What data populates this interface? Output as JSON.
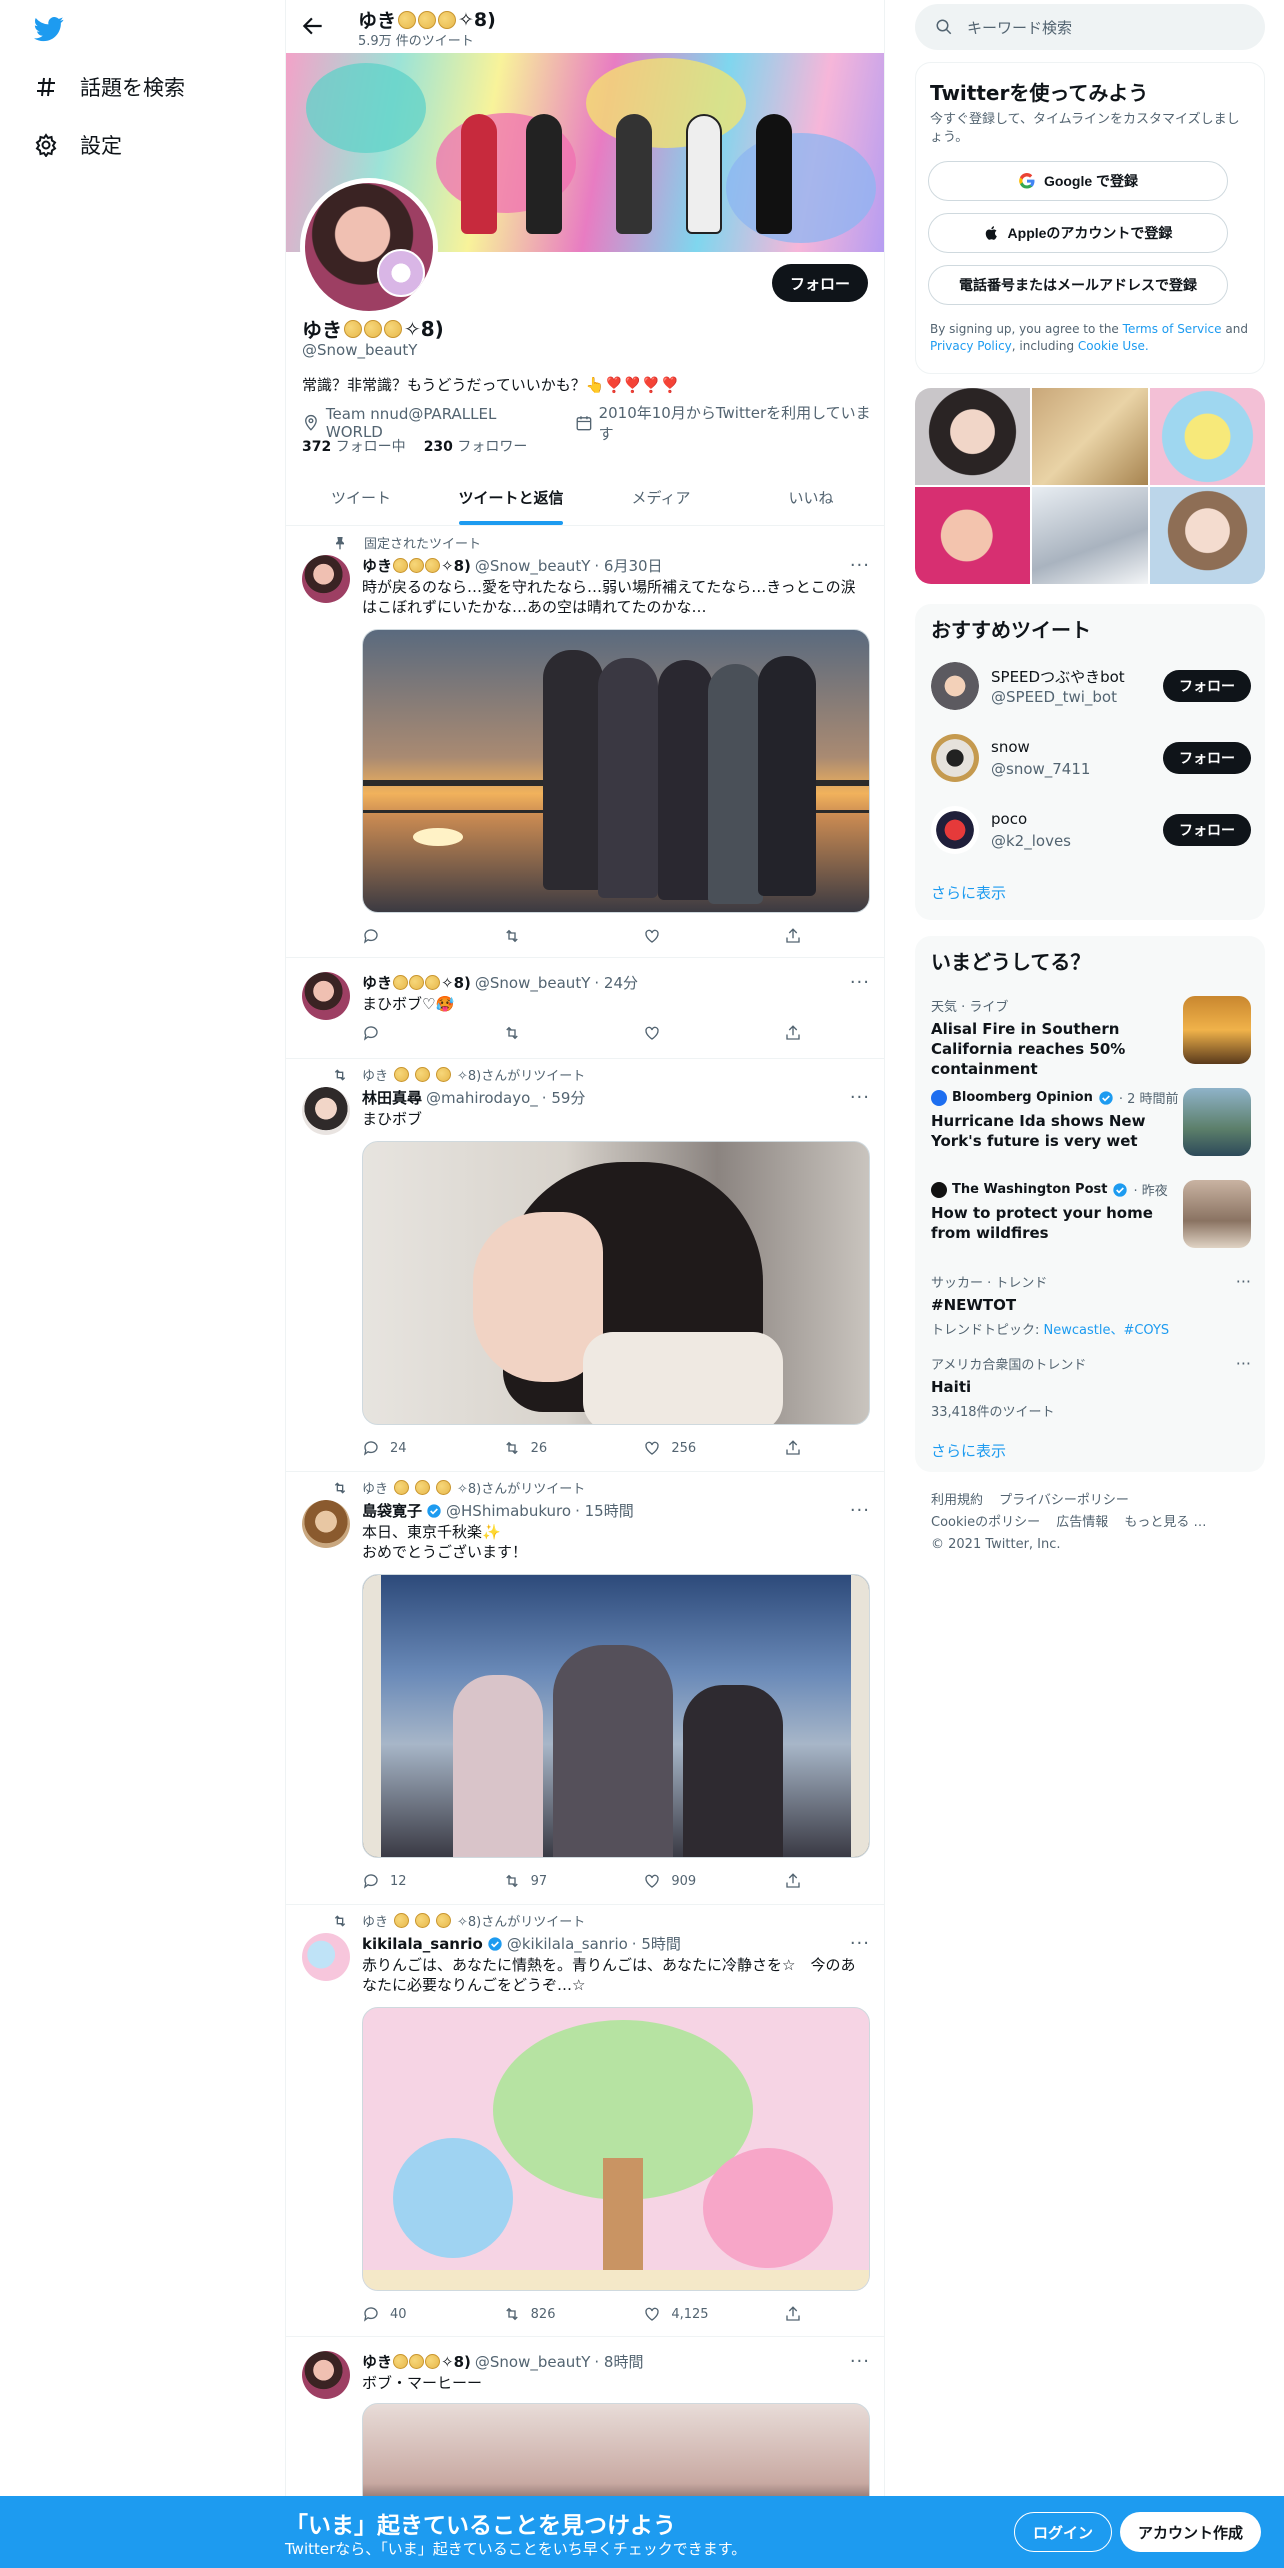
{
  "nav": {
    "explore_label": "話題を検索",
    "settings_label": "設定"
  },
  "profile": {
    "header_name": "ゆき",
    "header_suffix": "✧8)",
    "tweet_count": "5.9万 件のツイート",
    "name": "ゆき",
    "name_suffix": "✧8)",
    "handle": "@Snow_beautY",
    "bio": "常識？非常識？もうどうだっていいかも？👆❣️❣️❣️❣️",
    "location": "Team nnud@PARALLEL WORLD",
    "joined": "2010年10月からTwitterを利用しています",
    "following_count": "372",
    "following_label": "フォロー中",
    "followers_count": "230",
    "followers_label": "フォロワー",
    "follow_button": "フォロー"
  },
  "tabs": [
    "ツイート",
    "ツイートと返信",
    "メディア",
    "いいね"
  ],
  "tweets": [
    {
      "context": "固定されたツイート",
      "name": "ゆき",
      "name_suffix": "✧8)",
      "handle": "@Snow_beautY",
      "time": "· 6月30日",
      "text": "時が戻るのなら…愛を守れたなら…弱い場所補えてたなら…きっとこの涙はこぼれずにいたかな…あの空は晴れてたのかな…",
      "replies": "",
      "retweets": "",
      "likes": ""
    },
    {
      "name": "ゆき",
      "name_suffix": "✧8)",
      "handle": "@Snow_beautY",
      "time": "· 24分",
      "text": "まひボブ♡🥵",
      "replies": "",
      "retweets": "",
      "likes": ""
    },
    {
      "context_prefix": "ゆき",
      "context": "✧8)さんがリツイート",
      "name": "林田真尋",
      "handle": "@mahirodayo_",
      "time": "· 59分",
      "text": "まひボブ",
      "replies": "24",
      "retweets": "26",
      "likes": "256"
    },
    {
      "context_prefix": "ゆき",
      "context": "✧8)さんがリツイート",
      "name": "島袋寛子",
      "handle": "@HShimabukuro",
      "time": "· 15時間",
      "text": "本日、東京千秋楽✨\nおめでとうございます！",
      "replies": "12",
      "retweets": "97",
      "likes": "909"
    },
    {
      "context_prefix": "ゆき",
      "context": "✧8)さんがリツイート",
      "name": "kikilala_sanrio",
      "handle": "@kikilala_sanrio",
      "time": "· 5時間",
      "text": "赤りんごは、あなたに情熱を。青りんごは、あなたに冷静さを☆　今のあなたに必要なりんごをどうぞ…☆",
      "replies": "40",
      "retweets": "826",
      "likes": "4,125"
    },
    {
      "name": "ゆき",
      "name_suffix": "✧8)",
      "handle": "@Snow_beautY",
      "time": "· 8時間",
      "text": "ボブ・マーヒーー"
    }
  ],
  "right": {
    "search_placeholder": "キーワード検索",
    "signup": {
      "title": "Twitterを使ってみよう",
      "subtitle": "今すぐ登録して、タイムラインをカスタマイズしましょう。",
      "google": "Google で登録",
      "apple": "Appleのアカウントで登録",
      "phone": "電話番号またはメールアドレスで登録",
      "terms_prefix": "By signing up, you agree to the",
      "terms": "Terms of Service",
      "and": "and",
      "privacy": "Privacy Policy",
      "including": ", including",
      "cookie": "Cookie Use."
    },
    "recommend": {
      "title": "おすすめツイート",
      "accounts": [
        {
          "name": "SPEEDつぶやきbot",
          "handle": "@SPEED_twi_bot",
          "button": "フォロー"
        },
        {
          "name": "snow",
          "handle": "@snow_7411",
          "button": "フォロー"
        },
        {
          "name": "poco",
          "handle": "@k2_loves",
          "button": "フォロー"
        }
      ],
      "more": "さらに表示"
    },
    "trends": {
      "title": "いまどうしてる？",
      "items": [
        {
          "source": "天気 · ライブ",
          "title": "Alisal Fire in Southern California reaches 50% containment"
        },
        {
          "source_name": "Bloomberg Opinion",
          "source_time": "· 2 時間前",
          "title": "Hurricane Ida shows New York's future is very wet"
        },
        {
          "source_name": "The Washington Post",
          "source_time": "· 昨夜",
          "title": "How to protect your home from wildfires"
        },
        {
          "source": "サッカー · トレンド",
          "title": "#NEWTOT",
          "sub_prefix": "トレンドトピック: ",
          "sub_links": "Newcastle、#COYS"
        },
        {
          "source": "アメリカ合衆国のトレンド",
          "title": "Haiti",
          "sub": "33,418件のツイート"
        }
      ],
      "more": "さらに表示"
    },
    "footer": {
      "links": [
        "利用規約",
        "プライバシーポリシー",
        "Cookieのポリシー",
        "広告情報",
        "もっと見る …"
      ],
      "copyright": "© 2021 Twitter, Inc."
    }
  },
  "bottombar": {
    "title": "「いま」起きていることを見つけよう",
    "subtitle": "Twitterなら、「いま」起きていることをいち早くチェックできます。",
    "login": "ログイン",
    "signup": "アカウント作成"
  },
  "colors": {
    "brand": "#1d9bf0",
    "text": "#0f1419",
    "muted": "#536471"
  }
}
